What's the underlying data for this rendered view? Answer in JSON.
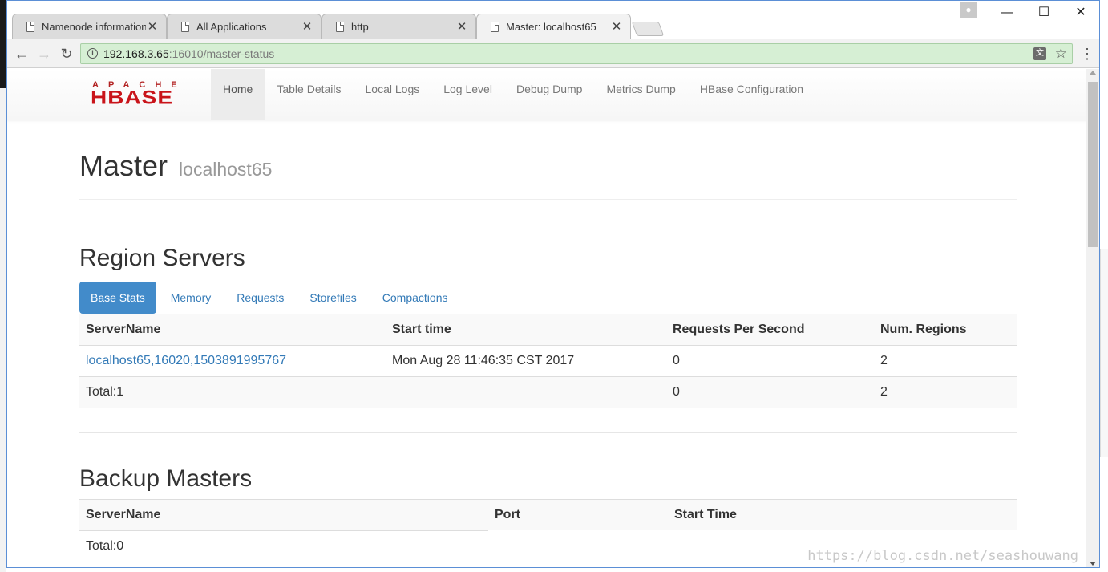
{
  "browser": {
    "tabs": [
      {
        "label": "Namenode information",
        "active": false
      },
      {
        "label": "All Applications",
        "active": false
      },
      {
        "label": "http",
        "active": false
      },
      {
        "label": "Master: localhost65",
        "active": true
      }
    ],
    "close_glyph": "✕",
    "window_controls": {
      "minimize": "—",
      "maximize": "☐",
      "close": "✕"
    },
    "address": {
      "host": "192.168.3.65",
      "rest": ":16010/master-status"
    },
    "icons": [
      "back-arrow-icon",
      "forward-arrow-icon",
      "reload-icon",
      "info-icon",
      "translate-icon",
      "star-icon",
      "menu-icon"
    ]
  },
  "nav": {
    "logo_top": "APACHE",
    "logo_main": "HBASE",
    "items": [
      "Home",
      "Table Details",
      "Local Logs",
      "Log Level",
      "Debug Dump",
      "Metrics Dump",
      "HBase Configuration"
    ],
    "active": "Home"
  },
  "header": {
    "title": "Master",
    "subtitle": "localhost65"
  },
  "region_servers": {
    "title": "Region Servers",
    "pills": [
      "Base Stats",
      "Memory",
      "Requests",
      "Storefiles",
      "Compactions"
    ],
    "columns": [
      "ServerName",
      "Start time",
      "Requests Per Second",
      "Num. Regions"
    ],
    "rows": [
      {
        "server": "localhost65,16020,1503891995767",
        "start": "Mon Aug 28 11:46:35 CST 2017",
        "rps": "0",
        "regions": "2"
      }
    ],
    "total": {
      "label": "Total:1",
      "rps": "0",
      "regions": "2"
    }
  },
  "backup_masters": {
    "title": "Backup Masters",
    "columns": [
      "ServerName",
      "Port",
      "Start Time"
    ],
    "total": "Total:0"
  },
  "watermark": "https://blog.csdn.net/seashouwang"
}
